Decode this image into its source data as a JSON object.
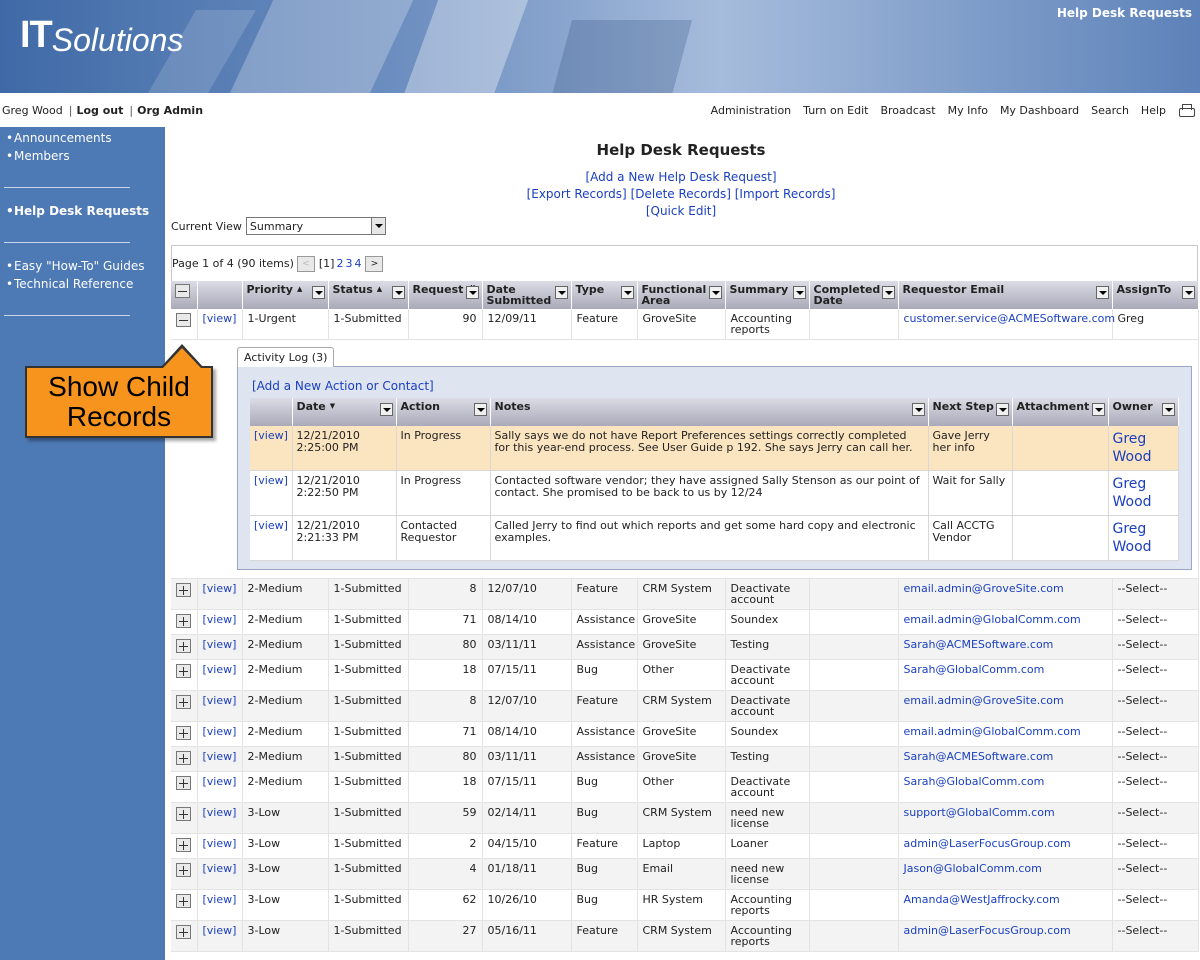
{
  "header": {
    "logo_it": "IT",
    "logo_solutions": "Solutions",
    "title": "Help Desk Requests"
  },
  "userbar": {
    "user": "Greg Wood",
    "logout": "Log out",
    "org_admin": "Org Admin"
  },
  "nav": [
    "Administration",
    "Turn on Edit",
    "Broadcast",
    "My Info",
    "My Dashboard",
    "Search",
    "Help"
  ],
  "sidebar": {
    "group1": [
      "Announcements",
      "Members"
    ],
    "group2": [
      "Help Desk Requests"
    ],
    "group3": [
      "Easy \"How-To\" Guides",
      "Technical Reference"
    ]
  },
  "callout": {
    "line1": "Show Child",
    "line2": "Records"
  },
  "main": {
    "title": "Help Desk Requests",
    "add_request": "[Add a New Help Desk Request]",
    "export": "[Export Records]",
    "delete": "[Delete Records]",
    "import": "[Import Records]",
    "quick_edit": "[Quick Edit]",
    "current_view_label": "Current View",
    "current_view_value": "Summary",
    "pager_text": "Page 1 of 4 (90 items)",
    "pager_prev": "<",
    "pager_next": ">",
    "pages": [
      "[1]",
      "2",
      "3",
      "4"
    ]
  },
  "grid": {
    "columns": [
      "Priority",
      "Status",
      "Request #",
      "Date Submitted",
      "Type",
      "Functional Area",
      "Summary",
      "Completed Date",
      "Requestor Email",
      "AssignTo"
    ],
    "view_label": "[view]",
    "expanded_row": {
      "priority": "1-Urgent",
      "status": "1-Submitted",
      "request": "90",
      "date": "12/09/11",
      "type": "Feature",
      "area": "GroveSite",
      "summary": "Accounting reports",
      "completed": "",
      "email": "customer.service@ACMESoftware.com",
      "assign": "Greg"
    },
    "rows": [
      {
        "priority": "2-Medium",
        "status": "1-Submitted",
        "request": "8",
        "date": "12/07/10",
        "type": "Feature",
        "area": "CRM System",
        "summary": "Deactivate account",
        "completed": "",
        "email": "email.admin@GroveSite.com",
        "assign": "--Select--"
      },
      {
        "priority": "2-Medium",
        "status": "1-Submitted",
        "request": "71",
        "date": "08/14/10",
        "type": "Assistance",
        "area": "GroveSite",
        "summary": "Soundex",
        "completed": "",
        "email": "email.admin@GlobalComm.com",
        "assign": "--Select--"
      },
      {
        "priority": "2-Medium",
        "status": "1-Submitted",
        "request": "80",
        "date": "03/11/11",
        "type": "Assistance",
        "area": "GroveSite",
        "summary": "Testing",
        "completed": "",
        "email": "Sarah@ACMESoftware.com",
        "assign": "--Select--"
      },
      {
        "priority": "2-Medium",
        "status": "1-Submitted",
        "request": "18",
        "date": "07/15/11",
        "type": "Bug",
        "area": "Other",
        "summary": "Deactivate account",
        "completed": "",
        "email": "Sarah@GlobalComm.com",
        "assign": "--Select--"
      },
      {
        "priority": "2-Medium",
        "status": "1-Submitted",
        "request": "8",
        "date": "12/07/10",
        "type": "Feature",
        "area": "CRM System",
        "summary": "Deactivate account",
        "completed": "",
        "email": "email.admin@GroveSite.com",
        "assign": "--Select--"
      },
      {
        "priority": "2-Medium",
        "status": "1-Submitted",
        "request": "71",
        "date": "08/14/10",
        "type": "Assistance",
        "area": "GroveSite",
        "summary": "Soundex",
        "completed": "",
        "email": "email.admin@GlobalComm.com",
        "assign": "--Select--"
      },
      {
        "priority": "2-Medium",
        "status": "1-Submitted",
        "request": "80",
        "date": "03/11/11",
        "type": "Assistance",
        "area": "GroveSite",
        "summary": "Testing",
        "completed": "",
        "email": "Sarah@ACMESoftware.com",
        "assign": "--Select--"
      },
      {
        "priority": "2-Medium",
        "status": "1-Submitted",
        "request": "18",
        "date": "07/15/11",
        "type": "Bug",
        "area": "Other",
        "summary": "Deactivate account",
        "completed": "",
        "email": "Sarah@GlobalComm.com",
        "assign": "--Select--"
      },
      {
        "priority": "3-Low",
        "status": "1-Submitted",
        "request": "59",
        "date": "02/14/11",
        "type": "Bug",
        "area": "CRM System",
        "summary": "need new license",
        "completed": "",
        "email": "support@GlobalComm.com",
        "assign": "--Select--"
      },
      {
        "priority": "3-Low",
        "status": "1-Submitted",
        "request": "2",
        "date": "04/15/10",
        "type": "Feature",
        "area": "Laptop",
        "summary": "Loaner",
        "completed": "",
        "email": "admin@LaserFocusGroup.com",
        "assign": "--Select--"
      },
      {
        "priority": "3-Low",
        "status": "1-Submitted",
        "request": "4",
        "date": "01/18/11",
        "type": "Bug",
        "area": "Email",
        "summary": "need new license",
        "completed": "",
        "email": "Jason@GlobalComm.com",
        "assign": "--Select--"
      },
      {
        "priority": "3-Low",
        "status": "1-Submitted",
        "request": "62",
        "date": "10/26/10",
        "type": "Bug",
        "area": "HR System",
        "summary": "Accounting reports",
        "completed": "",
        "email": "Amanda@WestJaffrocky.com",
        "assign": "--Select--"
      },
      {
        "priority": "3-Low",
        "status": "1-Submitted",
        "request": "27",
        "date": "05/16/11",
        "type": "Feature",
        "area": "CRM System",
        "summary": "Accounting reports",
        "completed": "",
        "email": "admin@LaserFocusGroup.com",
        "assign": "--Select--"
      }
    ]
  },
  "child": {
    "tab": "Activity Log (3)",
    "add": "[Add a New Action or Contact]",
    "columns": [
      "Date",
      "Action",
      "Notes",
      "Next Step",
      "Attachment",
      "Owner"
    ],
    "rows": [
      {
        "date": "12/21/2010 2:25:00 PM",
        "action": "In Progress",
        "notes": "Sally says we do not have Report Preferences settings correctly completed for this year-end process. See User Guide p 192. She says Jerry can call her.",
        "next": "Gave Jerry her info",
        "attachment": "",
        "owner": "Greg Wood"
      },
      {
        "date": "12/21/2010 2:22:50 PM",
        "action": "In Progress",
        "notes": "Contacted software vendor; they have assigned Sally Stenson as our point of contact. She promised to be back to us by 12/24",
        "next": "Wait for Sally",
        "attachment": "",
        "owner": "Greg Wood"
      },
      {
        "date": "12/21/2010 2:21:33 PM",
        "action": "Contacted Requestor",
        "notes": "Called Jerry to find out which reports and get some hard copy and electronic examples.",
        "next": "Call ACCTG Vendor",
        "attachment": "",
        "owner": "Greg Wood"
      }
    ]
  }
}
